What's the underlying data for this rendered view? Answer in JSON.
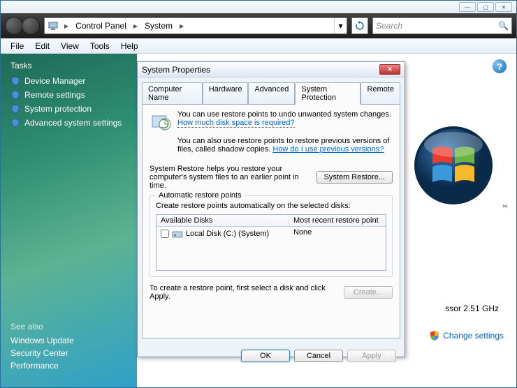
{
  "titlebar": {
    "min": "—",
    "max": "▢",
    "close": "✕"
  },
  "breadcrumb": {
    "seg1": "Control Panel",
    "seg2": "System"
  },
  "search": {
    "placeholder": "Search"
  },
  "menu": {
    "file": "File",
    "edit": "Edit",
    "view": "View",
    "tools": "Tools",
    "help": "Help"
  },
  "sidebar": {
    "tasks_header": "Tasks",
    "items": [
      {
        "label": "Device Manager"
      },
      {
        "label": "Remote settings"
      },
      {
        "label": "System protection"
      },
      {
        "label": "Advanced system settings"
      }
    ],
    "see_also_header": "See also",
    "see_also": [
      {
        "label": "Windows Update"
      },
      {
        "label": "Security Center"
      },
      {
        "label": "Performance"
      }
    ]
  },
  "content": {
    "spec": "ssor  2.51 GHz",
    "change_settings": "Change settings",
    "tm": "™"
  },
  "dialog": {
    "title": "System Properties",
    "tabs": {
      "computer_name": "Computer Name",
      "hardware": "Hardware",
      "advanced": "Advanced",
      "system_protection": "System Protection",
      "remote": "Remote"
    },
    "intro1": "You can use restore points to undo unwanted system changes. ",
    "intro1_link": "How much disk space is required?",
    "intro2": "You can also use restore points to restore previous versions of files, called shadow copies. ",
    "intro2_link": "How do I use previous versions?",
    "restore_desc": "System Restore helps you restore your computer's system files to an earlier point in time.",
    "restore_btn": "System Restore...",
    "group_title": "Automatic restore points",
    "group_desc": "Create restore points automatically on the selected disks:",
    "table": {
      "col1": "Available Disks",
      "col2": "Most recent restore point",
      "row1_disk": "Local Disk (C:) (System)",
      "row1_point": "None"
    },
    "create_desc": "To create a restore point, first select a disk and click Apply.",
    "create_btn": "Create...",
    "ok": "OK",
    "cancel": "Cancel",
    "apply": "Apply"
  }
}
